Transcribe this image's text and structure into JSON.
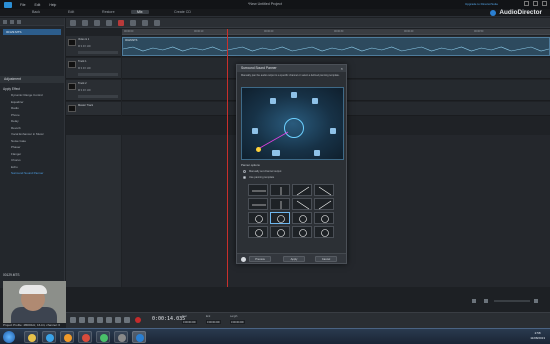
{
  "window": {
    "title": "*New Untitled Project",
    "menu": [
      "File",
      "Edit",
      "Help"
    ],
    "upgrade_link": "Upgrade to DirectorSuite"
  },
  "modes": {
    "tabs": [
      "Edit",
      "Restore",
      "Mix",
      "Create CD"
    ],
    "active": "Mix",
    "back_label": "Back"
  },
  "brand": {
    "name": "AudioDirector"
  },
  "media_library": {
    "items": [
      "00129.MTS"
    ]
  },
  "adjustment": {
    "header": "Adjustment",
    "group": "Apply Effect",
    "effects": [
      "Dynamic Range Control",
      "Equalizer",
      "Radio",
      "Phone",
      "Delay",
      "Reverb",
      "Vocal Enhancer in Music",
      "Noise Gate",
      "Phaser",
      "Flanger",
      "Chorus",
      "Echo",
      "Surround Sound Panner"
    ],
    "selected": "Surround Sound Panner"
  },
  "preview": {
    "label": "00129.MTS",
    "caption": "Project Profile: 48000Hz, 16-bit, channel: 6"
  },
  "tracks": [
    {
      "name": "Video & 1",
      "sub": "00129.MTS",
      "controls": "M S FX 100",
      "clip": "00129.MTS"
    },
    {
      "name": "Track 1",
      "sub": "",
      "controls": "M S FX 100",
      "clip": ""
    },
    {
      "name": "Track 2",
      "sub": "",
      "controls": "M S FX 100",
      "clip": ""
    },
    {
      "name": "Master Track",
      "sub": "",
      "controls": "",
      "clip": ""
    }
  ],
  "ruler_ticks": [
    "00:00:00",
    "00:00:10",
    "00:00:20",
    "00:00:30",
    "00:00:40",
    "00:00:50"
  ],
  "dialog": {
    "title": "Surround Sound Panner",
    "description": "Manually pan the audio output to a specific channel or select a defined panning template.",
    "options_label": "Panner options",
    "option_manual": "Manually set channel output",
    "option_template": "Use panning template",
    "selected_option": "template",
    "buttons": {
      "preview": "Preview",
      "apply": "Apply",
      "cancel": "Cancel"
    }
  },
  "transport": {
    "timecode": "0:00:14.035",
    "start_label": "Start",
    "start_value": "0:00:00.000",
    "end_label": "End",
    "end_value": "0:00:00.000",
    "length_label": "Length",
    "length_value": "0:00:00.000"
  },
  "clock": {
    "time": "2:58",
    "date": "11/08/2013"
  }
}
